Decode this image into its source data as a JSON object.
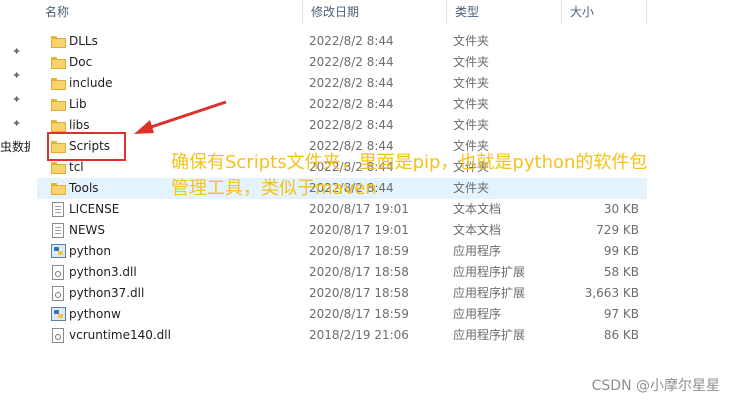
{
  "header": {
    "name": "名称",
    "date": "修改日期",
    "type": "类型",
    "size": "大小"
  },
  "left_strip": {
    "clip_text": "虫数据"
  },
  "files": [
    {
      "name": "DLLs",
      "date": "2022/8/2 8:44",
      "type": "文件夹",
      "size": "",
      "icon": "folder-icon"
    },
    {
      "name": "Doc",
      "date": "2022/8/2 8:44",
      "type": "文件夹",
      "size": "",
      "icon": "folder-icon"
    },
    {
      "name": "include",
      "date": "2022/8/2 8:44",
      "type": "文件夹",
      "size": "",
      "icon": "folder-icon"
    },
    {
      "name": "Lib",
      "date": "2022/8/2 8:44",
      "type": "文件夹",
      "size": "",
      "icon": "folder-icon"
    },
    {
      "name": "libs",
      "date": "2022/8/2 8:44",
      "type": "文件夹",
      "size": "",
      "icon": "folder-icon"
    },
    {
      "name": "Scripts",
      "date": "2022/8/2 8:44",
      "type": "文件夹",
      "size": "",
      "icon": "folder-icon"
    },
    {
      "name": "tcl",
      "date": "2022/8/2 8:44",
      "type": "文件夹",
      "size": "",
      "icon": "folder-icon"
    },
    {
      "name": "Tools",
      "date": "2022/8/2 8:44",
      "type": "文件夹",
      "size": "",
      "icon": "folder-icon"
    },
    {
      "name": "LICENSE",
      "date": "2020/8/17 19:01",
      "type": "文本文档",
      "size": "30 KB",
      "icon": "text-file-icon"
    },
    {
      "name": "NEWS",
      "date": "2020/8/17 19:01",
      "type": "文本文档",
      "size": "729 KB",
      "icon": "text-file-icon"
    },
    {
      "name": "python",
      "date": "2020/8/17 18:59",
      "type": "应用程序",
      "size": "99 KB",
      "icon": "python-exe-icon"
    },
    {
      "name": "python3.dll",
      "date": "2020/8/17 18:58",
      "type": "应用程序扩展",
      "size": "58 KB",
      "icon": "dll-file-icon"
    },
    {
      "name": "python37.dll",
      "date": "2020/8/17 18:58",
      "type": "应用程序扩展",
      "size": "3,663 KB",
      "icon": "dll-file-icon"
    },
    {
      "name": "pythonw",
      "date": "2020/8/17 18:59",
      "type": "应用程序",
      "size": "97 KB",
      "icon": "python-exe-icon"
    },
    {
      "name": "vcruntime140.dll",
      "date": "2018/2/19 21:06",
      "type": "应用程序扩展",
      "size": "86 KB",
      "icon": "dll-file-icon"
    }
  ],
  "selected_row": 7,
  "annotation": {
    "line1": "确保有Scripts文件夹，里面是pip，也就是python的软件包",
    "line2": "管理工具，类似于maven",
    "text_color": "#f5c218",
    "box_color": "#e0302a"
  },
  "watermark": "CSDN @小摩尔星星"
}
